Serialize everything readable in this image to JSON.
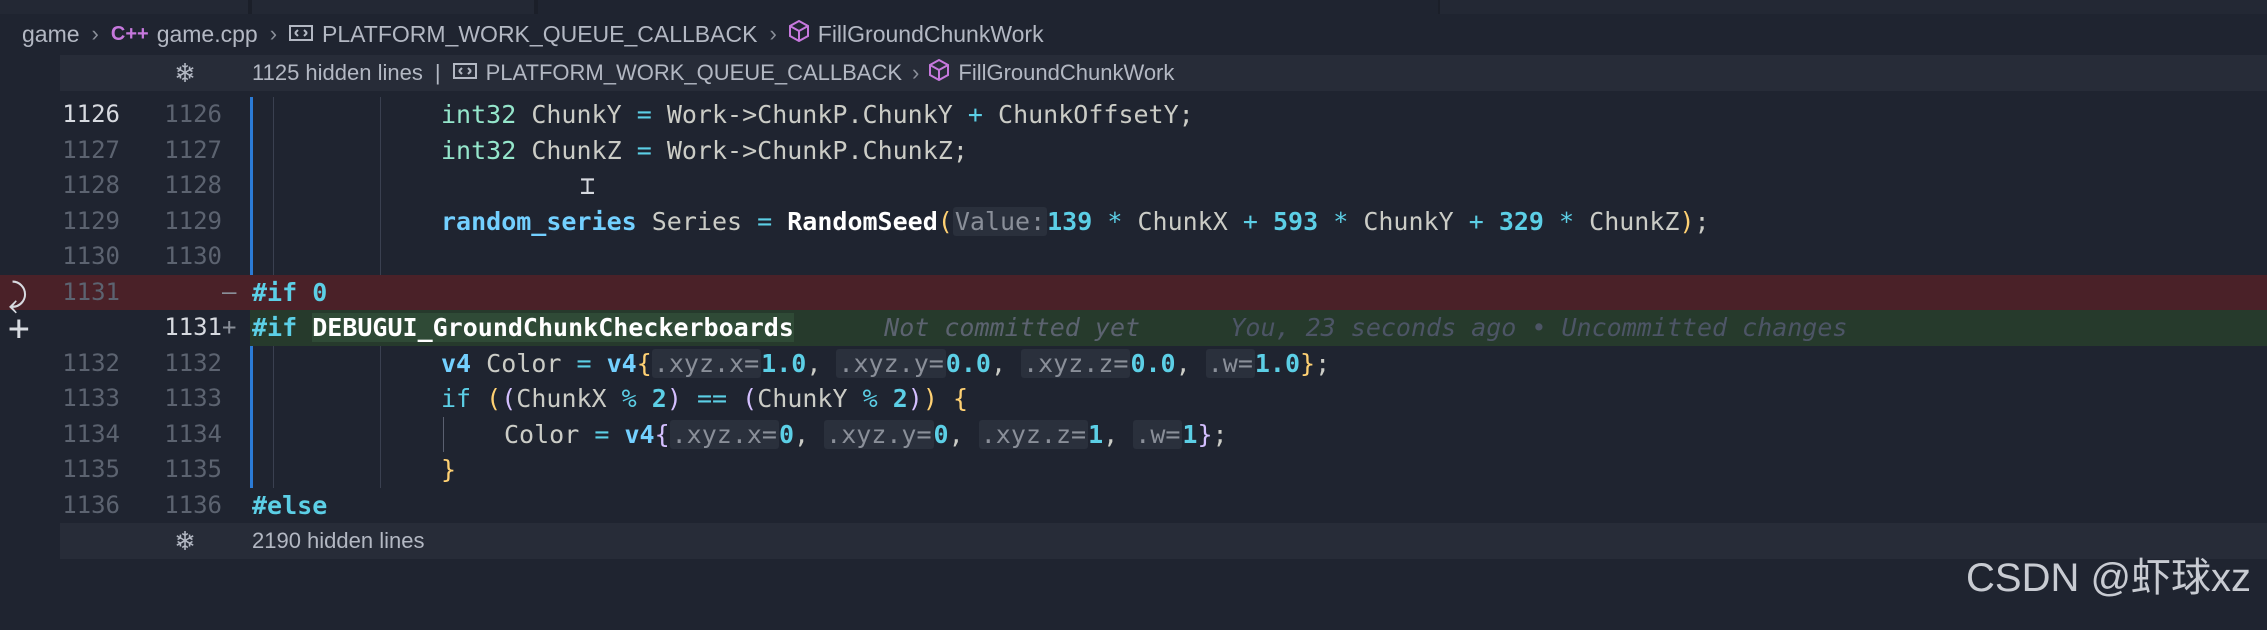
{
  "breadcrumb": {
    "folder": "game",
    "file_icon": "C++",
    "file": "game.cpp",
    "symbol1": "PLATFORM_WORK_QUEUE_CALLBACK",
    "symbol2": "FillGroundChunkWork"
  },
  "fold_top": {
    "text": "1125 hidden lines",
    "bar": "|",
    "symbol1": "PLATFORM_WORK_QUEUE_CALLBACK",
    "symbol2": "FillGroundChunkWork"
  },
  "fold_bottom": {
    "text": "2190 hidden lines"
  },
  "lines": {
    "l1126": {
      "a": "1126",
      "b": "1126"
    },
    "l1127": {
      "a": "1127",
      "b": "1127"
    },
    "l1128": {
      "a": "1128",
      "b": "1128"
    },
    "l1129": {
      "a": "1129",
      "b": "1129"
    },
    "l1130": {
      "a": "1130",
      "b": "1130"
    },
    "l1131r": {
      "a": "1131",
      "mark": "—"
    },
    "l1131a": {
      "b": "1131",
      "mark": "+"
    },
    "l1132": {
      "a": "1132",
      "b": "1132"
    },
    "l1133": {
      "a": "1133",
      "b": "1133"
    },
    "l1134": {
      "a": "1134",
      "b": "1134"
    },
    "l1135": {
      "a": "1135",
      "b": "1135"
    },
    "l1136": {
      "a": "1136",
      "b": "1136"
    }
  },
  "code": {
    "int32": "int32",
    "chunky_decl": "ChunkY",
    "chunkz_decl": "ChunkZ",
    "work": "Work",
    "arrow": "->",
    "chunkp": "ChunkP",
    "dot": ".",
    "chunky_field": "ChunkY",
    "chunkz_field": "ChunkZ",
    "plus": "+",
    "offset": "ChunkOffsetY",
    "eq": "=",
    "semi": ";",
    "random_series": "random_series",
    "series": "Series",
    "randomseed": "RandomSeed",
    "value_hint": "Value:",
    "n139": "139",
    "star": "*",
    "chunkx": "ChunkX",
    "n593": "593",
    "chunky": "ChunkY",
    "n329": "329",
    "chunkz": "ChunkZ",
    "if_pp": "#if",
    "zero": "0",
    "debug_macro": "DEBUGUI_GroundChunkCheckerboards",
    "blame1": "Not committed yet",
    "blame2": "You, 23 seconds ago • Uncommitted changes",
    "v4": "v4",
    "color": "Color",
    "hx": ".xyz.x=",
    "hy": ".xyz.y=",
    "hz": ".xyz.z=",
    "hw": ".w=",
    "f1": "1.0",
    "f0a": "0.0",
    "f0b": "0.0",
    "f1b": "1.0",
    "i0a": "0",
    "i0b": "0",
    "i1a": "1",
    "i1b": "1",
    "comma": ",",
    "if_kw": "if",
    "mod": "%",
    "two": "2",
    "eqeq": "==",
    "else_pp": "#else"
  },
  "watermark": "CSDN @虾球xz",
  "colors": {
    "background": "#1f2430",
    "removed_line": "#4a2128",
    "added_line": "#263a2c",
    "modified_bar": "#2b7bd6"
  }
}
